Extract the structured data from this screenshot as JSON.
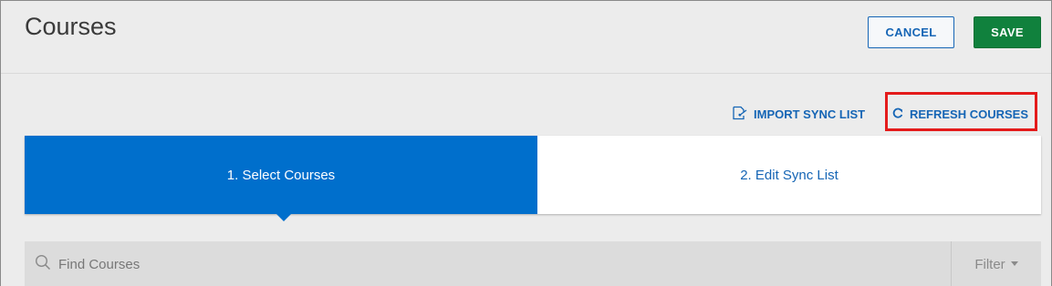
{
  "header": {
    "title": "Courses",
    "cancel_label": "CANCEL",
    "save_label": "SAVE"
  },
  "actions": {
    "import_label": "IMPORT SYNC LIST",
    "import_icon": "import-document-icon",
    "refresh_label": "REFRESH COURSES",
    "refresh_icon": "refresh-icon"
  },
  "steps": [
    {
      "label": "1. Select Courses",
      "active": true
    },
    {
      "label": "2. Edit Sync List",
      "active": false
    }
  ],
  "search": {
    "placeholder": "Find Courses",
    "icon": "search-icon",
    "filter_label": "Filter"
  },
  "colors": {
    "primary": "#006fcc",
    "link": "#1565b5",
    "save": "#10813d",
    "highlight": "#e41b1b"
  }
}
